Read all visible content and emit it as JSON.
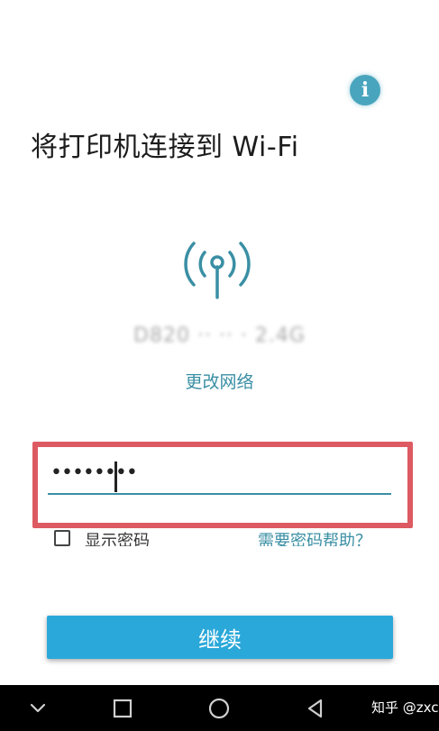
{
  "header": {
    "title": "将打印机连接到 Wi-Fi",
    "info_icon": "info-icon",
    "info_glyph": "i"
  },
  "network": {
    "name": "D820 ·· ·· · 2.4G",
    "change_link": "更改网络"
  },
  "password": {
    "value": "••••••••",
    "show_label": "显示密码",
    "show_checked": false,
    "help_link": "需要密码帮助？"
  },
  "actions": {
    "continue_label": "继续"
  },
  "navbar": {
    "items": [
      "chevron-down-icon",
      "recent-apps-icon",
      "home-icon",
      "back-icon"
    ],
    "watermark": "知乎 @zxc"
  },
  "colors": {
    "accent": "#3a8fa4",
    "button": "#2aa8d9",
    "highlight": "#dd5a62",
    "info": "#49a5bd"
  }
}
